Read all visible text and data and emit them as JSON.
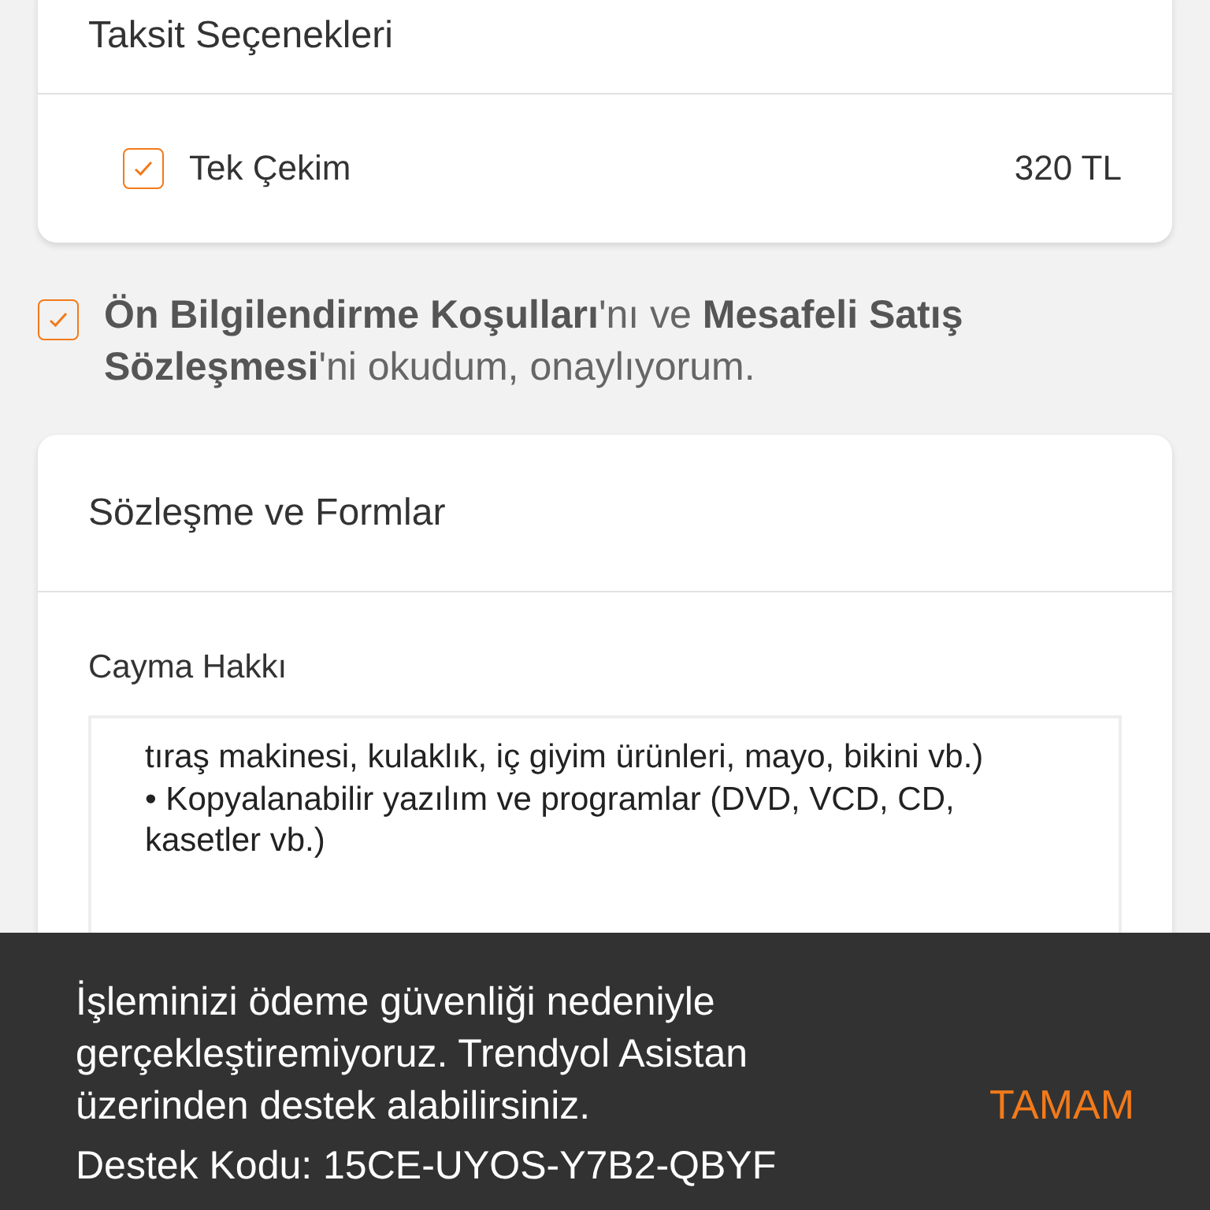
{
  "installments": {
    "title": "Taksit Seçenekleri",
    "options": [
      {
        "label": "Tek Çekim",
        "amount": "320 TL",
        "checked": true
      }
    ]
  },
  "agreement": {
    "checked": true,
    "text": "**Ön Bilgilendirme Koşulları**'nı ve **Mesafeli Satış Sözleşmesi**'ni okudum, onaylıyorum."
  },
  "contracts": {
    "title": "Sözleşme ve Formlar",
    "section": "Cayma Hakkı",
    "text_lines": [
      "tıraş makinesi, kulaklık, iç giyim ürünleri, mayo, bikini vb.)",
      "• Kopyalanabilir yazılım ve programlar (DVD, VCD, CD, kasetler vb.)"
    ]
  },
  "snackbar": {
    "message": "İşleminizi ödeme güvenliği nedeniyle gerçekleştiremiyoruz. Trendyol Asistan üzerinden destek alabilirsiniz.",
    "action": "TAMAM",
    "support_code": "Destek Kodu: 15CE-UYOS-Y7B2-QBYF"
  }
}
